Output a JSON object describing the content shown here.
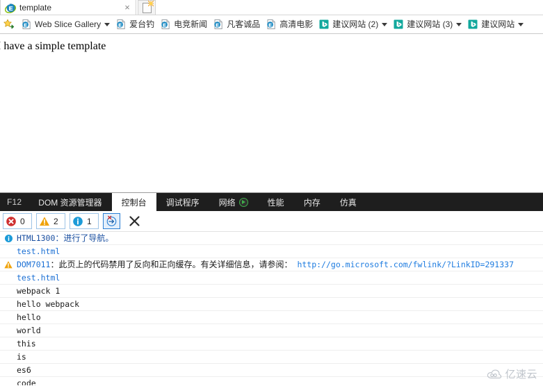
{
  "browser": {
    "tab": {
      "title": "template",
      "favicon_icon": "ie-logo-icon",
      "close_label": "×",
      "newtab_icon": "new-tab-icon"
    }
  },
  "favorites_bar": {
    "add_icon": "add-to-favorites-icon",
    "items": [
      {
        "label": "Web Slice Gallery",
        "icon": "ie-favicon-icon",
        "has_caret": true
      },
      {
        "label": "爱台钓",
        "icon": "ie-favicon-icon",
        "has_caret": false
      },
      {
        "label": "电竞新闻",
        "icon": "ie-favicon-icon",
        "has_caret": false
      },
      {
        "label": "凡客诚品",
        "icon": "ie-favicon-icon",
        "has_caret": false
      },
      {
        "label": "高清电影",
        "icon": "ie-favicon-icon",
        "has_caret": false
      },
      {
        "label": "建议网站 (2)",
        "icon": "bing-favicon-icon",
        "has_caret": true
      },
      {
        "label": "建议网站 (3)",
        "icon": "bing-favicon-icon",
        "has_caret": true
      },
      {
        "label": "建议网站",
        "icon": "bing-favicon-icon",
        "has_caret": true
      }
    ]
  },
  "page": {
    "body_text": "I have a simple template"
  },
  "devtools": {
    "f12_label": "F12",
    "tabs": [
      {
        "label": "DOM 资源管理器",
        "active": false,
        "icon": null
      },
      {
        "label": "控制台",
        "active": true,
        "icon": null
      },
      {
        "label": "调试程序",
        "active": false,
        "icon": null
      },
      {
        "label": "网络",
        "active": false,
        "icon": "play-icon"
      },
      {
        "label": "性能",
        "active": false,
        "icon": null
      },
      {
        "label": "内存",
        "active": false,
        "icon": null
      },
      {
        "label": "仿真",
        "active": false,
        "icon": null
      }
    ],
    "toolbar": {
      "error_count": "0",
      "warning_count": "2",
      "info_count": "1",
      "error_icon": "error-badge-icon",
      "warning_icon": "warning-badge-icon",
      "info_icon": "info-badge-icon",
      "clear_on_navigate_icon": "clear-on-navigate-icon",
      "clear_console_icon": "clear-console-icon"
    },
    "console_rows": [
      {
        "kind": "info",
        "icon": "info-icon",
        "code": "HTML1300",
        "sep": "：",
        "text": "进行了导航。",
        "link": null
      },
      {
        "kind": "source",
        "icon": null,
        "text": "test.html"
      },
      {
        "kind": "warn",
        "icon": "warning-icon",
        "code": "DOM7011",
        "sep": "：",
        "text": "此页上的代码禁用了反向和正向缓存。有关详细信息，请参阅：",
        "link": "http://go.microsoft.com/fwlink/?LinkID=291337"
      },
      {
        "kind": "source",
        "icon": null,
        "text": "test.html"
      },
      {
        "kind": "log",
        "icon": null,
        "text": "webpack 1"
      },
      {
        "kind": "log",
        "icon": null,
        "text": "hello webpack"
      },
      {
        "kind": "log",
        "icon": null,
        "text": "hello"
      },
      {
        "kind": "log",
        "icon": null,
        "text": "world"
      },
      {
        "kind": "log",
        "icon": null,
        "text": "this"
      },
      {
        "kind": "log",
        "icon": null,
        "text": "is"
      },
      {
        "kind": "log",
        "icon": null,
        "text": "es6"
      },
      {
        "kind": "log",
        "icon": null,
        "text": "code"
      }
    ]
  },
  "watermark": {
    "text": "亿速云",
    "icon": "cloud-logo-icon"
  },
  "colors": {
    "devtools_bar": "#1e1e1e",
    "info_blue": "#1a4fa0",
    "link_blue": "#1e7ce0",
    "warning_orange": "#f0a30a",
    "error_red": "#d03b3b"
  }
}
